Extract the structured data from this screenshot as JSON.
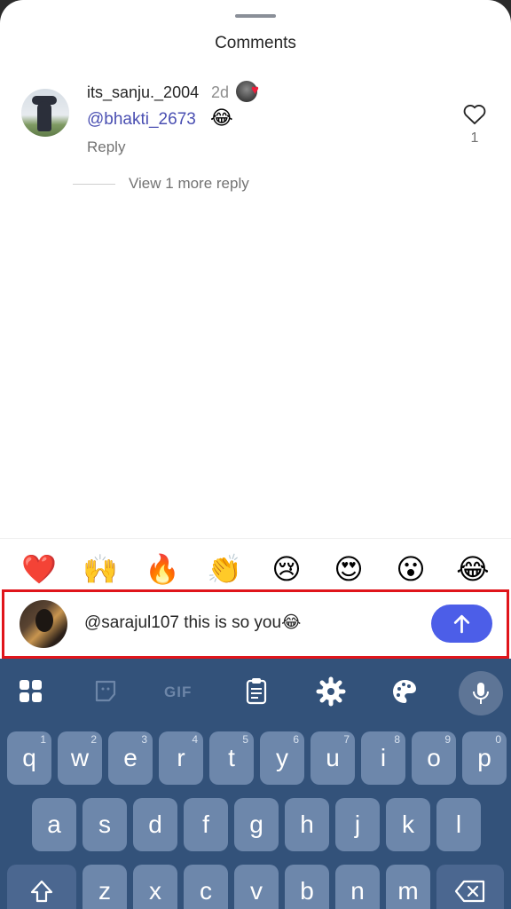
{
  "sheet": {
    "title": "Comments"
  },
  "comment": {
    "username": "its_sanju._2004",
    "time": "2d",
    "mention": "@bhakti_2673",
    "emoji": "😂",
    "reply_label": "Reply",
    "like_count": "1",
    "view_more_replies": "View 1 more reply"
  },
  "reactions": [
    "❤️",
    "🙌",
    "🔥",
    "👏",
    "😢",
    "😍",
    "😮",
    "😂"
  ],
  "composer": {
    "text": "@sarajul107 this is so you😂",
    "send_icon": "arrow-up-icon",
    "accent_color": "#4c5ee8"
  },
  "keyboard": {
    "gif_label": "GIF",
    "row1": [
      {
        "k": "q",
        "h": "1"
      },
      {
        "k": "w",
        "h": "2"
      },
      {
        "k": "e",
        "h": "3"
      },
      {
        "k": "r",
        "h": "4"
      },
      {
        "k": "t",
        "h": "5"
      },
      {
        "k": "y",
        "h": "6"
      },
      {
        "k": "u",
        "h": "7"
      },
      {
        "k": "i",
        "h": "8"
      },
      {
        "k": "o",
        "h": "9"
      },
      {
        "k": "p",
        "h": "0"
      }
    ],
    "row2": [
      "a",
      "s",
      "d",
      "f",
      "g",
      "h",
      "j",
      "k",
      "l"
    ],
    "row3": [
      "z",
      "x",
      "c",
      "v",
      "b",
      "n",
      "m"
    ],
    "background_color": "#33527a"
  }
}
